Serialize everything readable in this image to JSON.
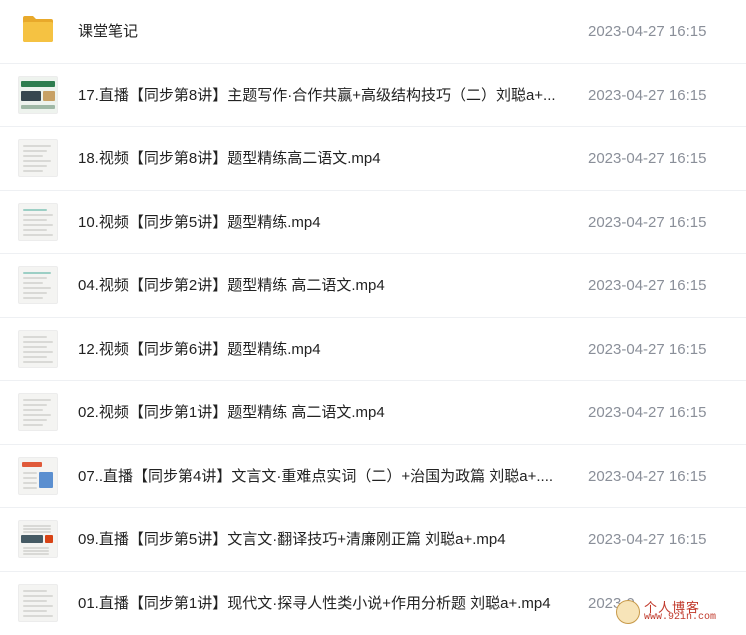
{
  "files": [
    {
      "name": "课堂笔记",
      "date": "2023-04-27 16:15",
      "kind": "folder",
      "thumb_icon": "folder-icon"
    },
    {
      "name": "17.直播【同步第8讲】主题写作·合作共赢+高级结构技巧（二）刘聪a+...",
      "date": "2023-04-27 16:15",
      "kind": "video",
      "thumb_icon": "video-thumbnail-icon"
    },
    {
      "name": "18.视频【同步第8讲】题型精练高二语文.mp4",
      "date": "2023-04-27 16:15",
      "kind": "video",
      "thumb_icon": "video-thumbnail-icon"
    },
    {
      "name": "10.视频【同步第5讲】题型精练.mp4",
      "date": "2023-04-27 16:15",
      "kind": "video",
      "thumb_icon": "video-thumbnail-icon"
    },
    {
      "name": "04.视频【同步第2讲】题型精练 高二语文.mp4",
      "date": "2023-04-27 16:15",
      "kind": "video",
      "thumb_icon": "video-thumbnail-icon"
    },
    {
      "name": "12.视频【同步第6讲】题型精练.mp4",
      "date": "2023-04-27 16:15",
      "kind": "video",
      "thumb_icon": "video-thumbnail-icon"
    },
    {
      "name": "02.视频【同步第1讲】题型精练 高二语文.mp4",
      "date": "2023-04-27 16:15",
      "kind": "video",
      "thumb_icon": "video-thumbnail-icon"
    },
    {
      "name": "07..直播【同步第4讲】文言文·重难点实词（二）+治国为政篇 刘聪a+....",
      "date": "2023-04-27 16:15",
      "kind": "video",
      "thumb_icon": "video-thumbnail-icon"
    },
    {
      "name": "09.直播【同步第5讲】文言文·翻译技巧+清廉刚正篇 刘聪a+.mp4",
      "date": "2023-04-27 16:15",
      "kind": "video",
      "thumb_icon": "video-thumbnail-icon"
    },
    {
      "name": "01.直播【同步第1讲】现代文·探寻人性类小说+作用分析题 刘聪a+.mp4",
      "date": "2023-0",
      "kind": "video",
      "thumb_icon": "video-thumbnail-icon"
    }
  ],
  "watermark": {
    "text": "个人博客",
    "url": "www.92in.com",
    "icon": "blog-logo-icon"
  },
  "colors": {
    "folder": "#f5c242",
    "date_text": "#8a8f99",
    "divider": "#eef0f3",
    "watermark": "#c0392b"
  }
}
